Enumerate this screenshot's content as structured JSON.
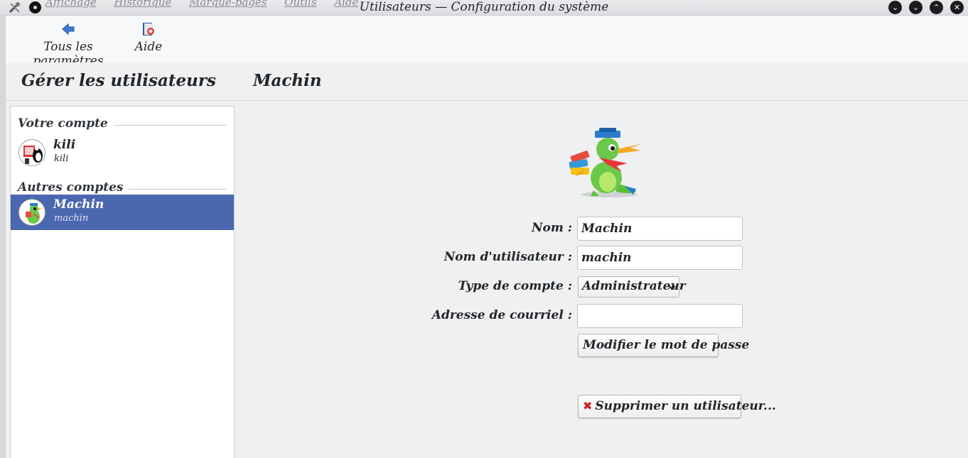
{
  "window": {
    "title": "Utilisateurs — Configuration du système",
    "background_menu": [
      "Affichage",
      "Historique",
      "Marque-pages",
      "Outils",
      "Aide"
    ]
  },
  "toolbar": {
    "all_settings": "Tous les paramètres",
    "help": "Aide"
  },
  "header": {
    "left_title": "Gérer les utilisateurs",
    "right_title": "Machin"
  },
  "accounts": {
    "own_section": "Votre compte",
    "own": {
      "name": "kili",
      "login": "kili"
    },
    "others_section": "Autres comptes",
    "others": [
      {
        "name": "Machin",
        "login": "machin",
        "selected": true
      }
    ]
  },
  "form": {
    "name_label": "Nom :",
    "name_value": "Machin",
    "username_label": "Nom d'utilisateur :",
    "username_value": "machin",
    "type_label": "Type de compte :",
    "type_value": "Administrateur",
    "email_label": "Adresse de courriel :",
    "email_value": "",
    "change_password": "Modifier le mot de passe",
    "delete_user": "Supprimer un utilisateur..."
  },
  "colors": {
    "selection": "#4b67b0",
    "window_bg": "#eff0f1",
    "delete_icon": "#d02020"
  }
}
